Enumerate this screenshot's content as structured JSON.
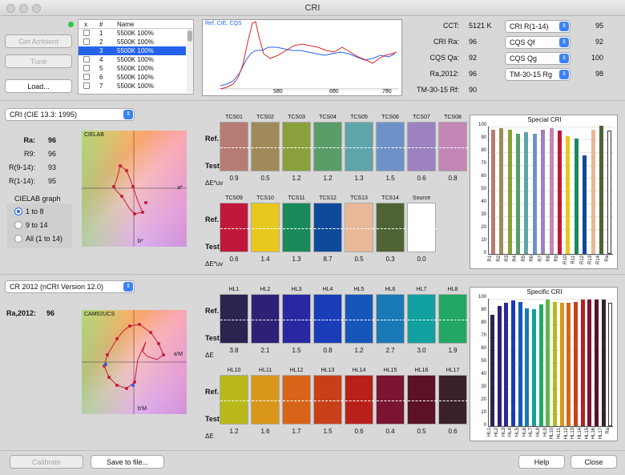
{
  "window": {
    "title": "CRI"
  },
  "buttons": {
    "get_ambient": "Get Ambient",
    "tune": "Tune",
    "load": "Load...",
    "calibrate": "Calibrate",
    "save": "Save to file...",
    "help": "Help",
    "close": "Close"
  },
  "table": {
    "headers": [
      "x",
      "#",
      "Name"
    ],
    "rows": [
      {
        "n": "1",
        "name": "5500K 100%",
        "checked": false,
        "selected": false
      },
      {
        "n": "2",
        "name": "5500K 100%",
        "checked": false,
        "selected": false
      },
      {
        "n": "3",
        "name": "5500K 100%",
        "checked": true,
        "selected": true
      },
      {
        "n": "4",
        "name": "5500K 100%",
        "checked": false,
        "selected": false
      },
      {
        "n": "5",
        "name": "5500K 100%",
        "checked": false,
        "selected": false
      },
      {
        "n": "6",
        "name": "5500K 100%",
        "checked": false,
        "selected": false
      },
      {
        "n": "7",
        "name": "5500K 100%",
        "checked": false,
        "selected": false
      }
    ]
  },
  "spectrum": {
    "legend": "Ref, CIE, CQS",
    "ticks": [
      "500",
      "600",
      "700"
    ]
  },
  "metrics": [
    {
      "label": "CCT:",
      "value": "5121 K",
      "select": "CRI R(1-14)",
      "sel_value": "95"
    },
    {
      "label": "CRI Ra:",
      "value": "96",
      "select": "CQS Qf",
      "sel_value": "92"
    },
    {
      "label": "CQS Qa:",
      "value": "92",
      "select": "CQS Qg",
      "sel_value": "100"
    },
    {
      "label": "Ra,2012:",
      "value": "96",
      "select": "TM-30-15 Rg",
      "sel_value": "98"
    },
    {
      "label": "TM-30-15 Rf:",
      "value": "90",
      "select": "",
      "sel_value": ""
    }
  ],
  "cri": {
    "select": "CRI (CIE 13.3: 1995)",
    "stats": [
      [
        "Ra:",
        "96"
      ],
      [
        "R9:",
        "96"
      ],
      [
        "R(9-14):",
        "93"
      ],
      [
        "R(1-14):",
        "95"
      ]
    ],
    "graph_title": "CIELAB graph",
    "radio": [
      "1 to 8",
      "9 to 14",
      "All (1 to 14)"
    ],
    "plot_label": "CIELAB",
    "axis_a": "a*",
    "axis_b": "b*",
    "ticks": [
      "-40",
      "-20",
      "0",
      "20",
      "40"
    ],
    "ref_label": "Ref.",
    "test_label": "Test",
    "delta_label": "ΔE*uv",
    "row1": {
      "caps": [
        "TCS01",
        "TCS02",
        "TCS03",
        "TCS04",
        "TCS05",
        "TCS06",
        "TCS07",
        "TCS08"
      ],
      "colors": [
        "#b77c73",
        "#a08a59",
        "#8aa03c",
        "#5a9d68",
        "#5ea4a8",
        "#6e92c7",
        "#9c82c0",
        "#c287b6"
      ],
      "vals": [
        "0.9",
        "0.5",
        "1.2",
        "1.2",
        "1.3",
        "1.5",
        "0.6",
        "0.8"
      ]
    },
    "row2": {
      "caps": [
        "TCS09",
        "TCS10",
        "TCS11",
        "TCS12",
        "TCS13",
        "TCS14",
        "Source"
      ],
      "colors": [
        "#c0183a",
        "#e8c81c",
        "#1a8a5a",
        "#0f4a9a",
        "#e8b898",
        "#4e6434",
        "#ffffff"
      ],
      "vals": [
        "0.6",
        "1.4",
        "1.3",
        "8.7",
        "0.5",
        "0.3",
        "0.0"
      ]
    }
  },
  "special_chart": {
    "title": "Special CRI",
    "yticks": [
      "100",
      "90",
      "80",
      "70",
      "60",
      "50",
      "40",
      "30",
      "20",
      "10",
      "0"
    ],
    "categories": [
      "R1",
      "R2",
      "R3",
      "R4",
      "R5",
      "R6",
      "R7",
      "R8",
      "R9",
      "R10",
      "R11",
      "R12",
      "R13",
      "R14",
      "Ra"
    ],
    "chart_data": {
      "type": "bar",
      "categories": [
        "R1",
        "R2",
        "R3",
        "R4",
        "R5",
        "R6",
        "R7",
        "R8",
        "R9",
        "R10",
        "R11",
        "R12",
        "R13",
        "R14",
        "Ra"
      ],
      "values": [
        97,
        98,
        97,
        94,
        95,
        94,
        97,
        98,
        96,
        92,
        90,
        77,
        97,
        100,
        96
      ],
      "ylim": [
        0,
        100
      ],
      "title": "Special CRI"
    },
    "colors": [
      "#b77c73",
      "#a08a59",
      "#8aa03c",
      "#5a9d68",
      "#5ea4a8",
      "#6e92c7",
      "#9c82c0",
      "#c287b6",
      "#c0183a",
      "#e8c81c",
      "#1a8a5a",
      "#0f4a9a",
      "#e8b898",
      "#4e6434",
      "#ffffff"
    ]
  },
  "cr2012": {
    "select": "CR 2012 (nCRI Version 12.0)",
    "ra_label": "Ra,2012:",
    "ra_value": "96",
    "plot_label": "CAM02UCS",
    "axis_a": "a'M",
    "axis_b": "b'M",
    "ticks": [
      "-60",
      "-40",
      "-20",
      "0",
      "20",
      "40",
      "60",
      "80"
    ],
    "ref_label": "Ref.",
    "test_label": "Test",
    "delta_label": "ΔE",
    "row1": {
      "caps": [
        "HL1",
        "HL2",
        "HL3",
        "HL4",
        "HL5",
        "HL6",
        "HL7",
        "HL8",
        "HL9"
      ],
      "colors": [
        "#2a2450",
        "#301f76",
        "#2a28a0",
        "#1a3cb8",
        "#1656b8",
        "#1a7ab8",
        "#12a0a0",
        "#22a864",
        "#5ab84a"
      ],
      "vals": [
        "3.8",
        "2.1",
        "1.5",
        "0.8",
        "1.2",
        "2.7",
        "3.0",
        "1.9",
        "0.4"
      ]
    },
    "row2": {
      "caps": [
        "HL10",
        "HL11",
        "HL12",
        "HL13",
        "HL14",
        "HL15",
        "HL16",
        "HL17"
      ],
      "colors": [
        "#b8b81a",
        "#d8961a",
        "#d8641a",
        "#c8401a",
        "#b8201a",
        "#7a1430",
        "#5a1224",
        "#3a2028"
      ],
      "vals": [
        "1.2",
        "1.6",
        "1.7",
        "1.5",
        "0.6",
        "0.4",
        "0.5",
        "0.6"
      ]
    }
  },
  "specific_chart": {
    "title": "Specific CRI",
    "yticks": [
      "100",
      "90",
      "80",
      "70",
      "60",
      "50",
      "40",
      "30",
      "20",
      "10",
      "0"
    ],
    "categories": [
      "HL1",
      "HL2",
      "HL3",
      "HL4",
      "HL5",
      "HL6",
      "HL7",
      "HL8",
      "HL9",
      "HL10",
      "HL11",
      "HL12",
      "HL13",
      "HL14",
      "HL15",
      "HL16",
      "HL17",
      "Ra"
    ],
    "chart_data": {
      "type": "bar",
      "categories": [
        "HL1",
        "HL2",
        "HL3",
        "HL4",
        "HL5",
        "HL6",
        "HL7",
        "HL8",
        "HL9",
        "HL10",
        "HL11",
        "HL12",
        "HL13",
        "HL14",
        "HL15",
        "HL16",
        "HL17",
        "Ra"
      ],
      "values": [
        87,
        94,
        96,
        98,
        97,
        92,
        91,
        95,
        99,
        97,
        96,
        96,
        97,
        99,
        99,
        99,
        99,
        96
      ],
      "ylim": [
        0,
        100
      ],
      "title": "Specific CRI"
    },
    "colors": [
      "#2a2450",
      "#301f76",
      "#2a28a0",
      "#1a3cb8",
      "#1656b8",
      "#1a7ab8",
      "#12a0a0",
      "#22a864",
      "#5ab84a",
      "#b8b81a",
      "#d8961a",
      "#d8641a",
      "#c8401a",
      "#b8201a",
      "#7a1430",
      "#5a1224",
      "#3a2028",
      "#ffffff"
    ]
  }
}
